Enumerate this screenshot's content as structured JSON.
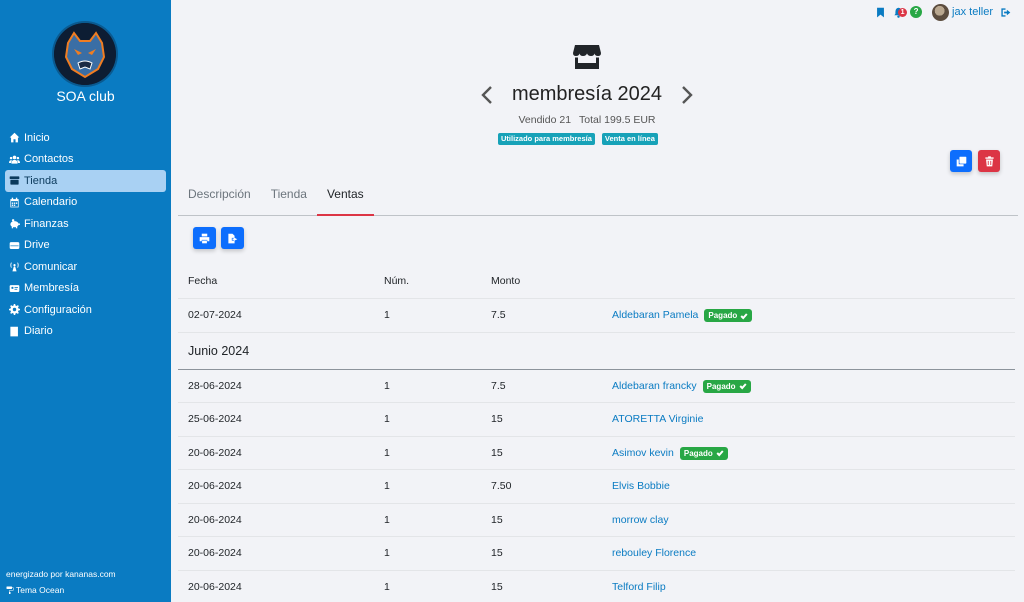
{
  "sidebar": {
    "club_name": "SOA club",
    "items": [
      {
        "label": "Inicio",
        "icon": "home-icon"
      },
      {
        "label": "Contactos",
        "icon": "users-icon"
      },
      {
        "label": "Tienda",
        "icon": "store-icon",
        "active": true
      },
      {
        "label": "Calendario",
        "icon": "calendar-icon"
      },
      {
        "label": "Finanzas",
        "icon": "piggy-bank-icon"
      },
      {
        "label": "Drive",
        "icon": "hard-drive-icon"
      },
      {
        "label": "Comunicar",
        "icon": "broadcast-icon"
      },
      {
        "label": "Membresía",
        "icon": "id-card-icon"
      },
      {
        "label": "Configuración",
        "icon": "gear-icon"
      },
      {
        "label": "Diario",
        "icon": "book-icon"
      }
    ],
    "powered_by": "energizado por kananas.com",
    "theme": "Tema Ocean"
  },
  "topbar": {
    "notification_count": "1",
    "help": "?",
    "username": "jax teller"
  },
  "product": {
    "title": "membresía 2024",
    "sold": "Vendido 21",
    "total": "Total 199.5 EUR",
    "tags": [
      "Utilizado para membresía",
      "Venta en línea"
    ]
  },
  "tabs": [
    "Descripción",
    "Tienda",
    "Ventas"
  ],
  "active_tab": "Ventas",
  "table": {
    "headers": [
      "Fecha",
      "Núm.",
      "Monto",
      ""
    ],
    "paid_label": "Pagado",
    "rows_top": [
      {
        "date": "02-07-2024",
        "num": "1",
        "amount": "7.5",
        "name": "Aldebaran Pamela",
        "paid": true
      }
    ],
    "month_label": "Junio 2024",
    "rows": [
      {
        "date": "28-06-2024",
        "num": "1",
        "amount": "7.5",
        "name": "Aldebaran francky",
        "paid": true
      },
      {
        "date": "25-06-2024",
        "num": "1",
        "amount": "15",
        "name": "ATORETTA Virginie",
        "paid": false
      },
      {
        "date": "20-06-2024",
        "num": "1",
        "amount": "15",
        "name": "Asimov kevin",
        "paid": true
      },
      {
        "date": "20-06-2024",
        "num": "1",
        "amount": "7.50",
        "name": "Elvis Bobbie",
        "paid": false
      },
      {
        "date": "20-06-2024",
        "num": "1",
        "amount": "15",
        "name": "morrow clay",
        "paid": false
      },
      {
        "date": "20-06-2024",
        "num": "1",
        "amount": "15",
        "name": "rebouley Florence",
        "paid": false
      },
      {
        "date": "20-06-2024",
        "num": "1",
        "amount": "15",
        "name": "Telford Filip",
        "paid": false
      }
    ]
  },
  "colors": {
    "sidebar": "#0a7bc2",
    "active_item": "#a9d1f3",
    "primary": "#0d6efd",
    "danger": "#dc3545",
    "success": "#28a745",
    "info": "#17a2b8"
  }
}
